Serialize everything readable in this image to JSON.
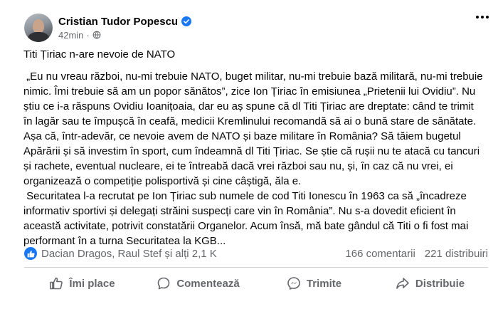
{
  "post": {
    "author": "Cristian Tudor Popescu",
    "time": "42min",
    "dot": "·",
    "title": "Titi Țiriac n-are nevoie de NATO",
    "paragraph1": " „Eu nu vreau război, nu-mi trebuie NATO, buget militar, nu-mi trebuie bază militară, nu-mi trebuie nimic. Îmi trebuie să am un popor sănătos”, zice Ion Țiriac în emisiunea „Prietenii lui Ovidiu”. Nu știu ce i-a răspuns Ovidiu Ioanițoaia, dar eu aș spune că dl Titi Țiriac are dreptate: când te trimit în lagăr sau te împușcă în ceafă, medicii Kremlinului recomandă să ai o bună stare de sănătate. Așa că, într-adevăr, ce nevoie avem de NATO și baze militare în România? Să tăiem bugetul Apărării și să investim în sport, cum îndeamnă dl Titi Țiriac. Se știe că rușii nu te atacă cu tancuri și rachete, eventual nucleare, ei te întreabă dacă vrei război sau nu, și, în caz că nu vrei, ei organizează o competiție polisportivă și cine câștigă, ăla e.",
    "paragraph2": " Securitatea l-a recrutat pe Ion Țiriac sub numele de cod Titi Ionescu în 1963 ca să „încadreze informativ sportivi și delegați străini suspecți care vin în România”. Nu s-a dovedit eficient în această activitate, potrivit constatării Organelor. Acum însă, mă bate gândul că Titi o fi fost mai performant în a turna Securitatea la KGB..."
  },
  "stats": {
    "reactions": "Dacian Dragos, Raul Stef și alți 2,1 K",
    "comments": "166 comentarii",
    "shares": "221 distribuiri"
  },
  "actions": {
    "like": "Îmi place",
    "comment": "Comentează",
    "send": "Trimite",
    "share": "Distribuie"
  },
  "colors": {
    "accent": "#1877f2",
    "secondary_text": "#65676b",
    "primary_text": "#050505"
  },
  "icons": [
    "avatar",
    "verified-badge-icon",
    "globe-icon",
    "more-options-icon",
    "like-reaction-icon",
    "thumbs-up-icon",
    "comment-icon",
    "messenger-icon",
    "share-icon"
  ]
}
